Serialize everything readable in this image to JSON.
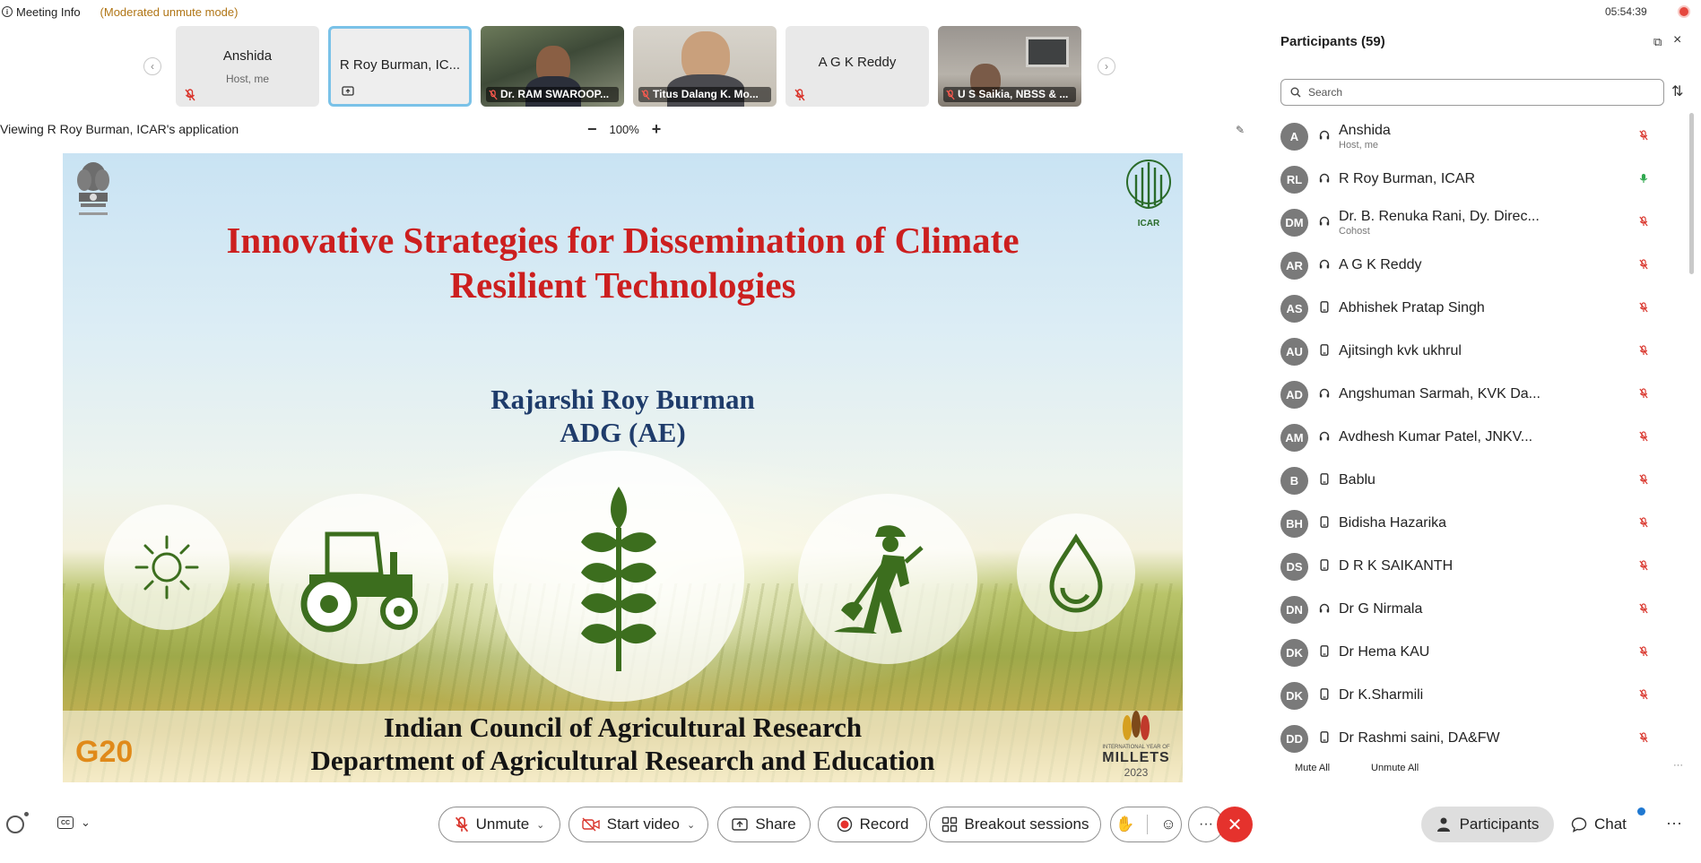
{
  "topbar": {
    "meeting_info_label": "Meeting Info",
    "mode_label": "(Moderated unmute mode)",
    "clock": "05:54:39"
  },
  "thumbnails": [
    {
      "name": "Anshida",
      "sub": "Host, me",
      "type": "avatar",
      "muted": true
    },
    {
      "name": "R Roy Burman, IC...",
      "sub": "",
      "type": "avatar",
      "active": true,
      "sharing": true
    },
    {
      "name": "Dr. RAM SWAROOP...",
      "type": "video",
      "muted": true
    },
    {
      "name": "Titus Dalang K. Mo...",
      "type": "video",
      "muted": true
    },
    {
      "name": "A G K Reddy",
      "sub": "",
      "type": "avatar",
      "muted": true
    },
    {
      "name": "U S Saikia, NBSS & ...",
      "type": "video",
      "muted": true
    }
  ],
  "viewing": {
    "text": "Viewing R Roy Burman, ICAR's application",
    "zoom_minus": "−",
    "zoom_level": "100%",
    "zoom_plus": "+"
  },
  "slide": {
    "title_line1": "Innovative Strategies for Dissemination of Climate",
    "title_line2": "Resilient Technologies",
    "author_name": "Rajarshi Roy Burman",
    "author_role": "ADG (AE)",
    "org_line1": "Indian Council of Agricultural Research",
    "org_line2": "Department of Agricultural Research and Education",
    "icar_label": "ICAR",
    "g20_label": "G20",
    "millets_intl": "INTERNATIONAL YEAR OF",
    "millets_label": "MILLETS",
    "millets_year": "2023"
  },
  "participants": {
    "title": "Participants (59)",
    "search_placeholder": "Search",
    "mute_all": "Mute All",
    "unmute_all": "Unmute All",
    "list": [
      {
        "initials": "A",
        "name": "Anshida",
        "sub": "Host, me",
        "device": "headset",
        "mic": "off"
      },
      {
        "initials": "RL",
        "name": "R Roy Burman, ICAR",
        "sub": "",
        "device": "headset",
        "mic": "on",
        "badge": true
      },
      {
        "initials": "DM",
        "name": "Dr. B. Renuka Rani, Dy. Direc...",
        "sub": "Cohost",
        "device": "headset",
        "mic": "off"
      },
      {
        "initials": "AR",
        "name": "A G K Reddy",
        "sub": "",
        "device": "headset",
        "mic": "off"
      },
      {
        "initials": "AS",
        "name": "Abhishek Pratap Singh",
        "sub": "",
        "device": "phone",
        "mic": "off"
      },
      {
        "initials": "AU",
        "name": "Ajitsingh kvk ukhrul",
        "sub": "",
        "device": "phone",
        "mic": "off"
      },
      {
        "initials": "AD",
        "name": "Angshuman Sarmah, KVK Da...",
        "sub": "",
        "device": "headset",
        "mic": "off"
      },
      {
        "initials": "AM",
        "name": "Avdhesh Kumar Patel, JNKV...",
        "sub": "",
        "device": "headset",
        "mic": "off"
      },
      {
        "initials": "B",
        "name": "Bablu",
        "sub": "",
        "device": "phone",
        "mic": "off"
      },
      {
        "initials": "BH",
        "name": "Bidisha Hazarika",
        "sub": "",
        "device": "phone",
        "mic": "off"
      },
      {
        "initials": "DS",
        "name": "D R K SAIKANTH",
        "sub": "",
        "device": "phone",
        "mic": "off"
      },
      {
        "initials": "DN",
        "name": "Dr G Nirmala",
        "sub": "",
        "device": "headset",
        "mic": "off"
      },
      {
        "initials": "DK",
        "name": "Dr Hema KAU",
        "sub": "",
        "device": "phone",
        "mic": "off"
      },
      {
        "initials": "DK",
        "name": "Dr K.Sharmili",
        "sub": "",
        "device": "phone",
        "mic": "off"
      },
      {
        "initials": "DD",
        "name": "Dr Rashmi saini, DA&FW",
        "sub": "",
        "device": "phone",
        "mic": "off"
      }
    ]
  },
  "toolbar": {
    "unmute": "Unmute",
    "start_video": "Start video",
    "share": "Share",
    "record": "Record",
    "breakout": "Breakout sessions",
    "participants": "Participants",
    "chat": "Chat"
  },
  "colors": {
    "title_red": "#cc1f1f",
    "author_blue": "#1f3c6b",
    "end_call_red": "#e5322d",
    "muted_red": "#d9342b",
    "active_blue": "#7ac2e8",
    "icon_green": "#3c6e1e"
  }
}
